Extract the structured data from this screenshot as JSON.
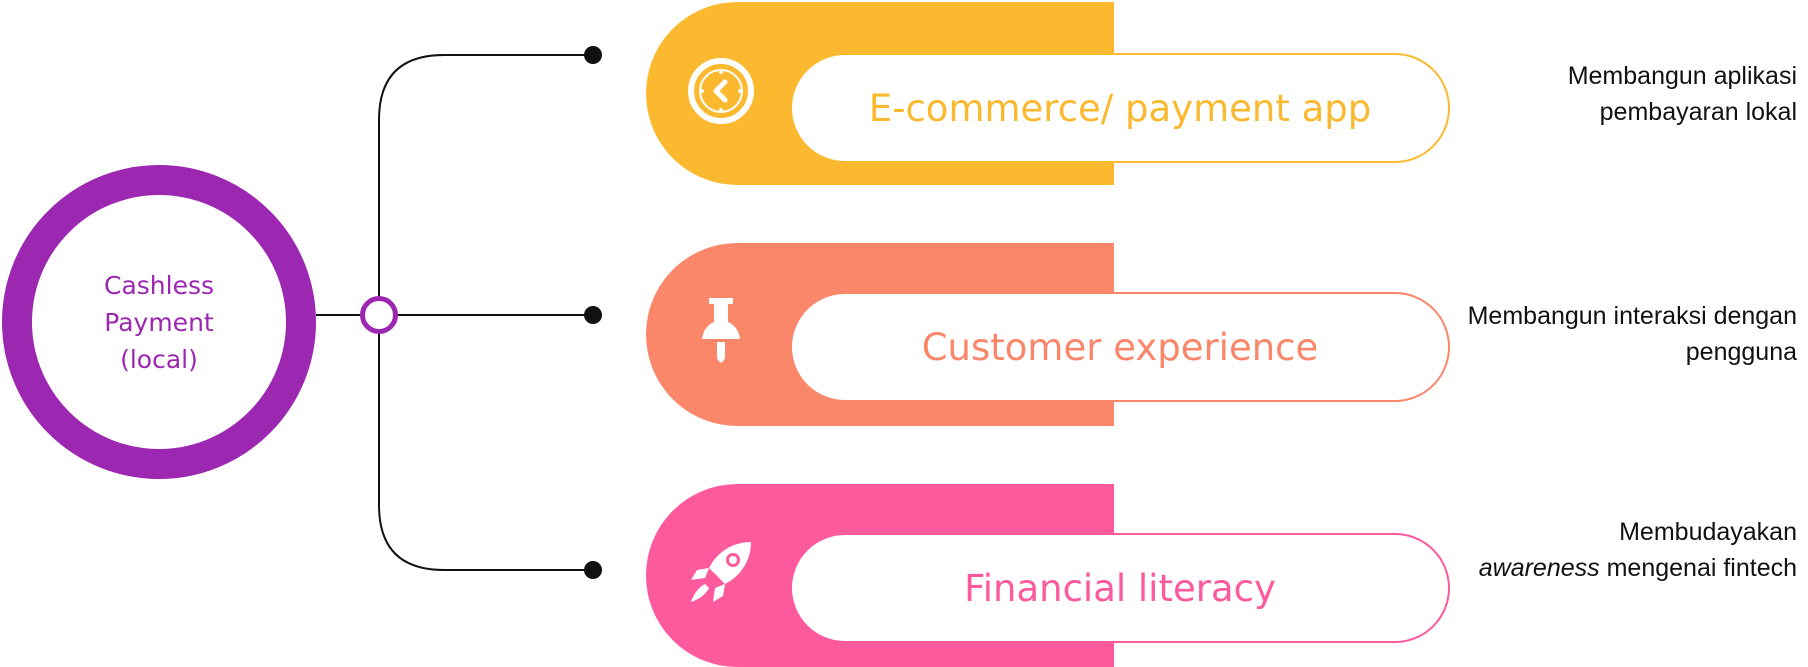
{
  "colors": {
    "hub": "#9c27b0",
    "connector": "#111111",
    "card_1": "#fbb930",
    "card_2": "#fb876b",
    "card_3": "#fc5a9c"
  },
  "hub": {
    "label": "Cashless\nPayment\n(local)"
  },
  "branches": [
    {
      "icon": "clock-icon",
      "label": "E-commerce/ payment app",
      "description": "Membangun aplikasi pembayaran lokal"
    },
    {
      "icon": "pushpin-icon",
      "label": "Customer experience",
      "description": "Membangun interaksi dengan pengguna"
    },
    {
      "icon": "rocket-icon",
      "label": "Financial literacy",
      "description_before": "Membudayakan",
      "description_emphasis": "awareness",
      "description_after": "mengenai fintech"
    }
  ]
}
